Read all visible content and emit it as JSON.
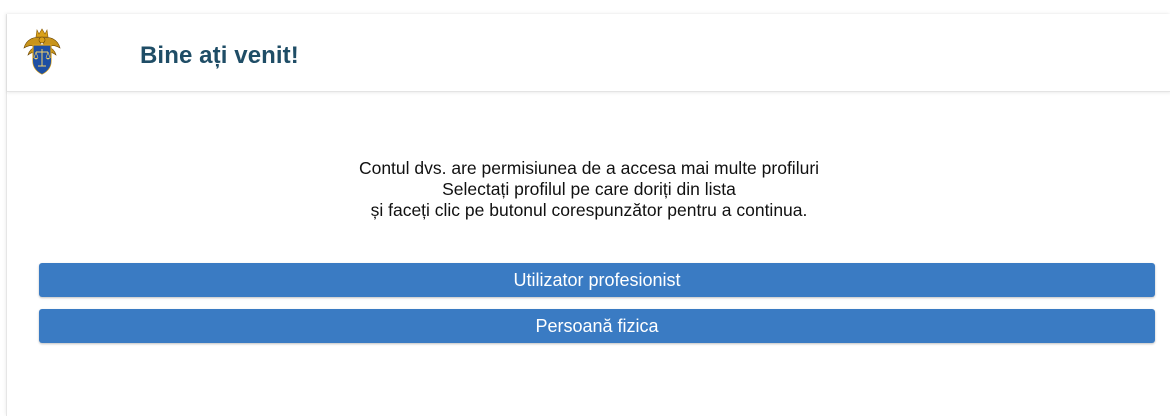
{
  "header": {
    "title": "Bine ați venit!",
    "emblem_icon": "moldova-coat-of-arms-icon"
  },
  "message": {
    "line1": "Contul dvs. are permisiunea de a accesa mai multe profiluri",
    "line2": "Selectați profilul pe care doriți din lista",
    "line3": "și faceți clic pe butonul corespunzător pentru a continua."
  },
  "profiles": [
    {
      "label": "Utilizator profesionist"
    },
    {
      "label": "Persoană fizica"
    }
  ],
  "colors": {
    "title": "#1f4d66",
    "button": "#3a7bc3",
    "button_text": "#ffffff"
  }
}
